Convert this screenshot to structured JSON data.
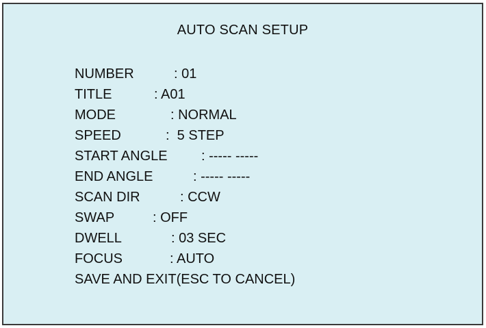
{
  "screen": {
    "title": "AUTO SCAN SETUP",
    "background_color": "#d9eff3",
    "text_color": "#111111"
  },
  "menu": {
    "items": [
      {
        "label": "NUMBER",
        "value": ": 01"
      },
      {
        "label": "TITLE",
        "value": ": A01"
      },
      {
        "label": "MODE",
        "value": ": NORMAL"
      },
      {
        "label": "SPEED",
        "value": ":  5 STEP"
      },
      {
        "label": "START ANGLE",
        "value": ": ----- -----"
      },
      {
        "label": "END ANGLE",
        "value": ": ----- -----"
      },
      {
        "label": "SCAN DIR",
        "value": ": CCW"
      },
      {
        "label": "SWAP",
        "value": ": OFF"
      },
      {
        "label": "DWELL",
        "value": ": 03 SEC"
      },
      {
        "label": "FOCUS",
        "value": ": AUTO"
      }
    ],
    "save_exit_label": "SAVE AND EXIT(ESC TO CANCEL)"
  }
}
